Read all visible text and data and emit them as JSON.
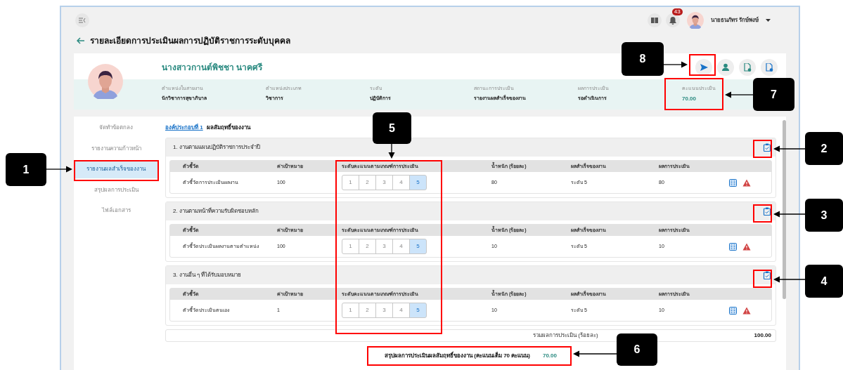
{
  "top_bar": {
    "notification_count": "43",
    "user_name": "นายธนภัทร รักษ์พงษ์"
  },
  "page_title": "รายละเอียดการประเมินผลการปฏิบัติราชการระดับบุคคล",
  "profile": {
    "name": "นางสาวกานต์พิชชา นาคศรี",
    "actions": [
      {
        "kind": "send"
      },
      {
        "kind": "person"
      },
      {
        "kind": "file-green"
      },
      {
        "kind": "file-blue"
      }
    ],
    "fields": [
      {
        "label": "ตำแหน่งในสายงาน",
        "value": "นักวิชาการสุขาภิบาล",
        "kind": "text"
      },
      {
        "label": "ตำแหน่งประเภท",
        "value": "วิชาการ",
        "kind": "text"
      },
      {
        "label": "ระดับ",
        "value": "ปฏิบัติการ",
        "kind": "text"
      },
      {
        "label": "สถานะการประเมิน",
        "value": "รายงานผลสำเร็จของงาน",
        "kind": "text"
      },
      {
        "label": "ผลการประเมิน",
        "value": "รอดำเนินการ",
        "kind": "text"
      },
      {
        "label": "คะแนนประเมิน",
        "value": "70.00",
        "kind": "score"
      }
    ]
  },
  "sidebar": {
    "items": [
      {
        "label": "จัดทำข้อตกลง",
        "selected": false
      },
      {
        "label": "รายงานความก้าวหน้า",
        "selected": false
      },
      {
        "label": "รายงานผลสำเร็จของงาน",
        "selected": true
      },
      {
        "label": "สรุปผลการประเมิน",
        "selected": false
      },
      {
        "label": "ไฟล์เอกสาร",
        "selected": false
      }
    ]
  },
  "component": {
    "link": "องค์ประกอบที่ 1",
    "title": "ผลสัมฤทธิ์ของงาน"
  },
  "sections": [
    {
      "title": "1. งานตามแผนปฏิบัติราชการประจำปี",
      "columns": [
        "ตัวชี้วัด",
        "ค่าเป้าหมาย",
        "ระดับคะแนนตามเกณฑ์การประเมิน",
        "น้ำหนัก (ร้อยละ)",
        "ผลสำเร็จของงาน",
        "ผลการประเมิน"
      ],
      "rows": [
        {
          "indicator": "ตัวชี้วัดการประเมินผลงาน",
          "target": "100",
          "levels": [
            {
              "label": "1",
              "selected": false
            },
            {
              "label": "2",
              "selected": false
            },
            {
              "label": "3",
              "selected": false
            },
            {
              "label": "4",
              "selected": false
            },
            {
              "label": "5",
              "selected": true
            }
          ],
          "weight": "80",
          "achievement": "ระดับ 5",
          "result": "80"
        }
      ]
    },
    {
      "title": "2. งานตามหน้าที่ความรับผิดชอบหลัก",
      "columns": [
        "ตัวชี้วัด",
        "ค่าเป้าหมาย",
        "ระดับคะแนนตามเกณฑ์การประเมิน",
        "น้ำหนัก (ร้อยละ)",
        "ผลสำเร็จของงาน",
        "ผลการประเมิน"
      ],
      "rows": [
        {
          "indicator": "ตัวชี้วัดประเมินผลงานตามตำแหน่ง",
          "target": "100",
          "levels": [
            {
              "label": "1",
              "selected": false
            },
            {
              "label": "2",
              "selected": false
            },
            {
              "label": "3",
              "selected": false
            },
            {
              "label": "4",
              "selected": false
            },
            {
              "label": "5",
              "selected": true
            }
          ],
          "weight": "10",
          "achievement": "ระดับ 5",
          "result": "10"
        }
      ]
    },
    {
      "title": "3. งานอื่น ๆ ที่ได้รับมอบหมาย",
      "columns": [
        "ตัวชี้วัด",
        "ค่าเป้าหมาย",
        "ระดับคะแนนตามเกณฑ์การประเมิน",
        "น้ำหนัก (ร้อยละ)",
        "ผลสำเร็จของงาน",
        "ผลการประเมิน"
      ],
      "rows": [
        {
          "indicator": "ตัวชี้วัดประเมินตนเอง",
          "target": "1",
          "levels": [
            {
              "label": "1",
              "selected": false
            },
            {
              "label": "2",
              "selected": false
            },
            {
              "label": "3",
              "selected": false
            },
            {
              "label": "4",
              "selected": false
            },
            {
              "label": "5",
              "selected": true
            }
          ],
          "weight": "10",
          "achievement": "ระดับ 5",
          "result": "10"
        }
      ]
    }
  ],
  "total": {
    "label": "รวมผลการประเมิน (ร้อยละ)",
    "value": "100.00"
  },
  "summary": {
    "label": "สรุปผลการประเมินผลสัมฤทธิ์ของงาน (คะแนนเต็ม 70 คะแนน)",
    "value": "70.00"
  },
  "annotations": [
    {
      "label": "1"
    },
    {
      "label": "2"
    },
    {
      "label": "3"
    },
    {
      "label": "4"
    },
    {
      "label": "5"
    },
    {
      "label": "6"
    },
    {
      "label": "7"
    },
    {
      "label": "8"
    }
  ]
}
